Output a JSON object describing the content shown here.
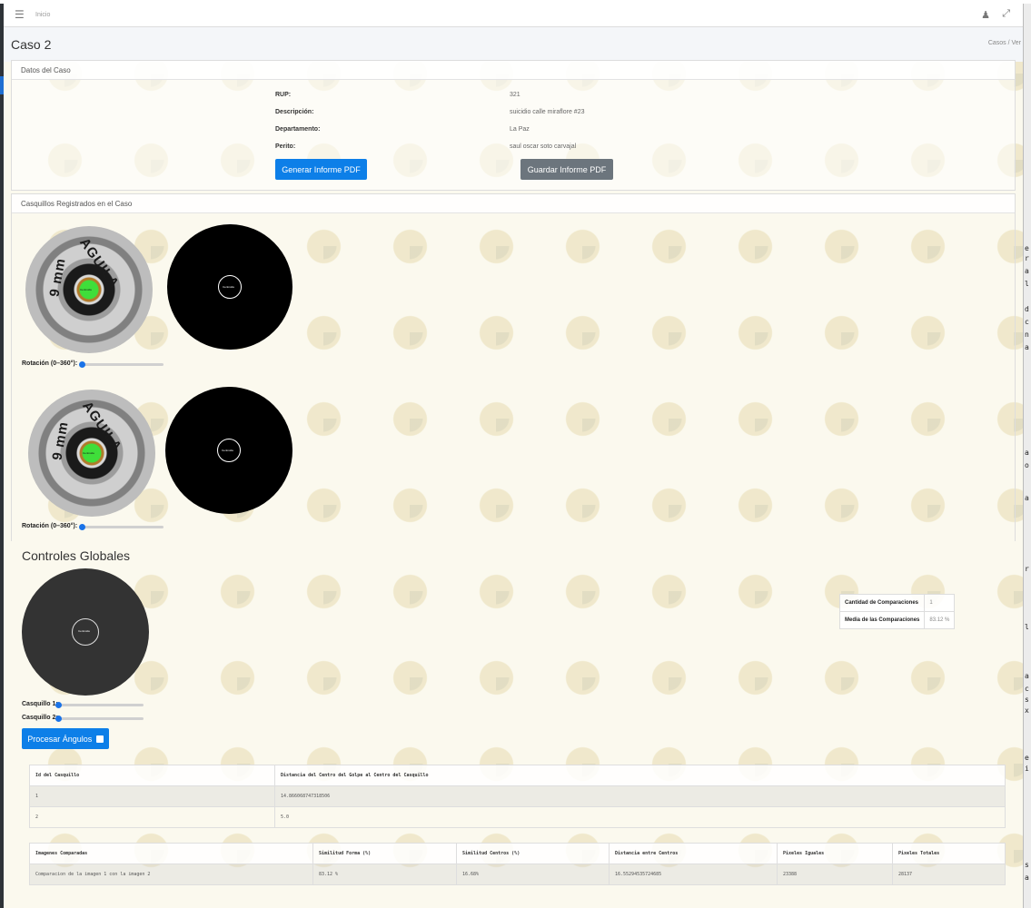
{
  "topbar": {
    "home_label": "Inicio",
    "menu_icon": "hamburger-icon",
    "user_icon": "user-icon",
    "expand_icon": "expand-icon"
  },
  "header": {
    "title": "Caso 2",
    "breadcrumb": "Casos / Ver"
  },
  "case_card": {
    "header": "Datos del Caso",
    "fields": [
      {
        "label": "RUP:",
        "value": "321"
      },
      {
        "label": "Descripción:",
        "value": "suicidio calle miraflore #23"
      },
      {
        "label": "Departamento:",
        "value": "La Paz"
      },
      {
        "label": "Perito:",
        "value": "saul oscar soto carvajal"
      }
    ],
    "generate_button": "Generar Informe PDF",
    "save_button": "Guardar Informe PDF"
  },
  "casings_card": {
    "header": "Casquillos Registrados en el Caso",
    "casing_text": "AGUILA",
    "caliber_text": "9 mm",
    "center_label": "Centroide",
    "items": [
      {
        "rotation_label": "Rotación (0–360°):",
        "rotation_value": 0
      },
      {
        "rotation_label": "Rotación (0–360°):",
        "rotation_value": 0
      }
    ]
  },
  "global_controls": {
    "title": "Controles Globales",
    "casing1_label": "Casquillo 1:",
    "casing2_label": "Casquillo 2:",
    "casing1_value": 0,
    "casing2_value": 0,
    "process_button": "Procesar Ángulos"
  },
  "stats": {
    "count_label": "Cantidad de Comparaciones",
    "count_value": "1",
    "mean_label": "Media de las Comparaciones",
    "mean_value": "83.12 %"
  },
  "distance_table": {
    "headers": [
      "Id del Casquillo",
      "Distancia del Centro del Golpe al Centro del Casquillo"
    ],
    "rows": [
      [
        "1",
        "14.866068747318506"
      ],
      [
        "2",
        "5.0"
      ]
    ]
  },
  "comparison_table": {
    "headers": [
      "Imagenes Comparadas",
      "Similitud Forma (%)",
      "Similitud Centros (%)",
      "Distancia entre Centros",
      "Pixeles Iguales",
      "Pixeles Totales"
    ],
    "rows": [
      [
        "Comparacion de la imagen 1 con la imagen 2",
        "83.12 %",
        "16.68%",
        "16.55294535724685",
        "23388",
        "28137"
      ]
    ]
  },
  "right_strip": [
    "e",
    "r",
    "a",
    "l",
    "d",
    "c",
    "n",
    "a",
    "a",
    "o",
    "a",
    "r",
    "l",
    "a",
    "c",
    "s",
    "x",
    "e",
    "i",
    "s",
    "a"
  ]
}
